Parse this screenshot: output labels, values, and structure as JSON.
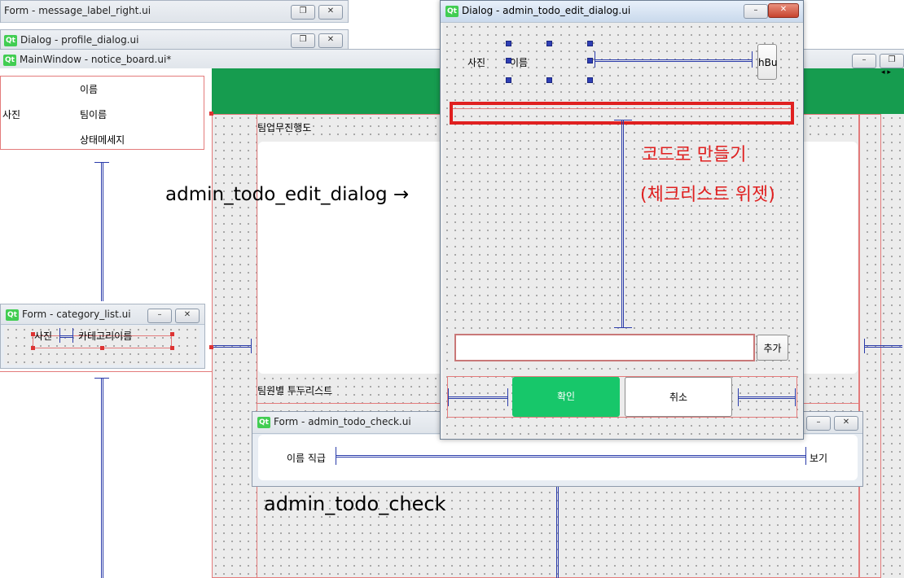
{
  "windows": {
    "form_message_label": {
      "title": "Form - message_label_right.ui"
    },
    "dialog_profile": {
      "title": "Dialog - profile_dialog.ui"
    },
    "main_window": {
      "title": "MainWindow - notice_board.ui*"
    },
    "category_list": {
      "title": "Form - category_list.ui",
      "photo_label": "사진",
      "category_label": "카테고리이름"
    },
    "admin_todo_check": {
      "title": "Form - admin_todo_check.ui",
      "name_rank_label": "이름 직급",
      "view_button": "보기"
    },
    "admin_todo_edit": {
      "title": "Dialog - admin_todo_edit_dialog.ui",
      "photo_label": "사진",
      "name_label": "이름",
      "hbu_button": "hBu",
      "add_button": "추가",
      "confirm_button": "확인",
      "cancel_button": "취소"
    }
  },
  "profile_panel": {
    "photo_label": "사진",
    "name_label": "이름",
    "team_name_label": "팀이름",
    "status_message_label": "상태메세지"
  },
  "main": {
    "team_progress_label": "팀업무진행도",
    "team_todo_label": "팀원별 투두리스트"
  },
  "annotations": {
    "edit_dialog_arrow": "admin_todo_edit_dialog →",
    "code_note_line1": "코드로 만들기",
    "code_note_line2": "(체크리스트 위젯)",
    "check_label": "admin_todo_check"
  },
  "colors": {
    "accent_green": "#169c4f",
    "confirm_green": "#17c76a",
    "annotation_red": "#e02020",
    "spring_blue": "#2b3caa"
  },
  "icons": {
    "qt": "qt-logo-icon",
    "minimize": "minimize-icon",
    "restore": "restore-icon",
    "close": "close-icon"
  }
}
